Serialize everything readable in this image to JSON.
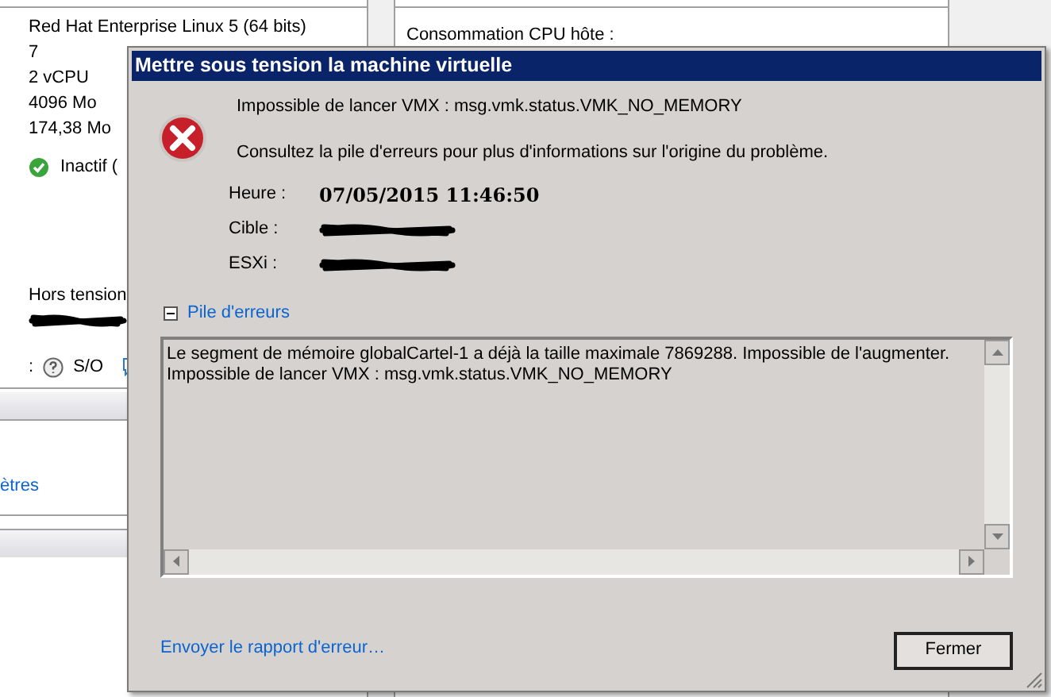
{
  "background": {
    "vm_details": [
      "Red Hat Enterprise Linux 5 (64 bits)",
      "7",
      "2 vCPU",
      "4096 Mo",
      "174,38 Mo"
    ],
    "status": {
      "label": "Inactif (",
      "ok": true
    },
    "power_state": "Hors tension",
    "status_row": {
      "separator": ":",
      "value": "S/O"
    },
    "settings_link": "ètres",
    "cpu_label": "Consommation CPU hôte :"
  },
  "dialog": {
    "title": "Mettre sous tension la machine virtuelle",
    "error_message": "Impossible de lancer VMX : msg.vmk.status.VMK_NO_MEMORY",
    "hint": "Consultez la pile d'erreurs pour plus d'informations sur l'origine du problème.",
    "fields": [
      {
        "label": "Heure :",
        "kind": "text",
        "value": "07/05/2015 11:46:50"
      },
      {
        "label": "Cible :",
        "kind": "redacted"
      },
      {
        "label": "ESXi :",
        "kind": "redacted"
      }
    ],
    "error_stack": {
      "label": "Pile d'erreurs",
      "expanded": true,
      "lines": [
        "Le segment de mémoire globalCartel-1 a déjà la taille maximale 7869288. Impossible de l'augmenter.",
        "Impossible de lancer VMX : msg.vmk.status.VMK_NO_MEMORY"
      ]
    },
    "report_link": "Envoyer le rapport d'erreur…",
    "close_button": "Fermer"
  }
}
